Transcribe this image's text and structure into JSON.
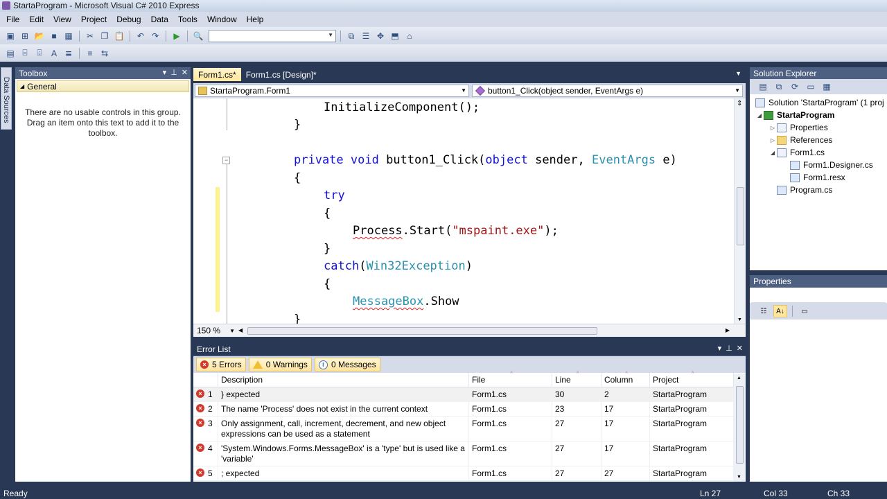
{
  "window": {
    "title": "StartaProgram - Microsoft Visual C# 2010 Express"
  },
  "menu": [
    "File",
    "Edit",
    "View",
    "Project",
    "Debug",
    "Data",
    "Tools",
    "Window",
    "Help"
  ],
  "side_strip": {
    "label": "Data Sources"
  },
  "toolbox": {
    "title": "Toolbox",
    "group": "General",
    "empty_message": "There are no usable controls in this group. Drag an item onto this text to add it to the toolbox."
  },
  "editor": {
    "tabs": [
      {
        "label": "Form1.cs*",
        "active": true
      },
      {
        "label": "Form1.cs [Design]*",
        "active": false
      }
    ],
    "nav_class": "StartaProgram.Form1",
    "nav_member": "button1_Click(object sender, EventArgs e)",
    "zoom": "150 %",
    "lines": [
      "InitializeComponent();",
      "}",
      "",
      "private void button1_Click(object sender, EventArgs e)",
      "{",
      "try",
      "{",
      "Process.Start(\"mspaint.exe\");",
      "}",
      "catch(Win32Exception)",
      "{",
      "MessageBox.Show",
      "}"
    ],
    "tokens": {
      "l0": "InitializeComponent();",
      "l1": "}",
      "l3_kw1": "private",
      "l3_kw2": "void",
      "l3_m": "button1_Click(",
      "l3_kw3": "object",
      "l3_p": "sender,",
      "l3_t": "EventArgs",
      "l3_e": "e)",
      "l4": "{",
      "l5": "try",
      "l6": "{",
      "l7_cls": "Process",
      "l7_m": ".Start(",
      "l7_str": "\"mspaint.exe\"",
      "l7_end": ");",
      "l8": "}",
      "l9_kw": "catch",
      "l9_open": "(",
      "l9_t": "Win32Exception",
      "l9_close": ")",
      "l10": "{",
      "l11_t": "MessageBox",
      "l11_m": ".Show",
      "l12": "}"
    }
  },
  "error_list": {
    "title": "Error List",
    "filters": {
      "errors": "5 Errors",
      "warnings": "0 Warnings",
      "messages": "0 Messages"
    },
    "columns": [
      "Description",
      "File",
      "Line",
      "Column",
      "Project"
    ],
    "rows": [
      {
        "num": "1",
        "description": "} expected",
        "file": "Form1.cs",
        "line": "30",
        "column": "2",
        "project": "StartaProgram"
      },
      {
        "num": "2",
        "description": "The name 'Process' does not exist in the current context",
        "file": "Form1.cs",
        "line": "23",
        "column": "17",
        "project": "StartaProgram"
      },
      {
        "num": "3",
        "description": "Only assignment, call, increment, decrement, and new object expressions can be used as a statement",
        "file": "Form1.cs",
        "line": "27",
        "column": "17",
        "project": "StartaProgram"
      },
      {
        "num": "4",
        "description": "'System.Windows.Forms.MessageBox' is a 'type' but is used like a 'variable'",
        "file": "Form1.cs",
        "line": "27",
        "column": "17",
        "project": "StartaProgram"
      },
      {
        "num": "5",
        "description": "; expected",
        "file": "Form1.cs",
        "line": "27",
        "column": "27",
        "project": "StartaProgram"
      }
    ]
  },
  "solution_explorer": {
    "title": "Solution Explorer",
    "items": [
      {
        "label": "Solution 'StartaProgram' (1 proj",
        "icon": "solution-icon"
      },
      {
        "label": "StartaProgram",
        "icon": "csharp-project-icon",
        "bold": true
      },
      {
        "label": "Properties",
        "icon": "properties-folder-icon"
      },
      {
        "label": "References",
        "icon": "references-folder-icon"
      },
      {
        "label": "Form1.cs",
        "icon": "form-icon"
      },
      {
        "label": "Form1.Designer.cs",
        "icon": "cs-file-icon"
      },
      {
        "label": "Form1.resx",
        "icon": "resx-file-icon"
      },
      {
        "label": "Program.cs",
        "icon": "cs-file-icon"
      }
    ]
  },
  "properties": {
    "title": "Properties"
  },
  "status": {
    "left": "Ready",
    "ln": "Ln 27",
    "col": "Col 33",
    "ch": "Ch 33"
  },
  "colors": {
    "chrome": "#293955",
    "panel_header": "#4d6082",
    "keyword": "#1212d6",
    "type": "#2b91af",
    "string": "#a31515",
    "active_tab": "#ffe79b"
  }
}
